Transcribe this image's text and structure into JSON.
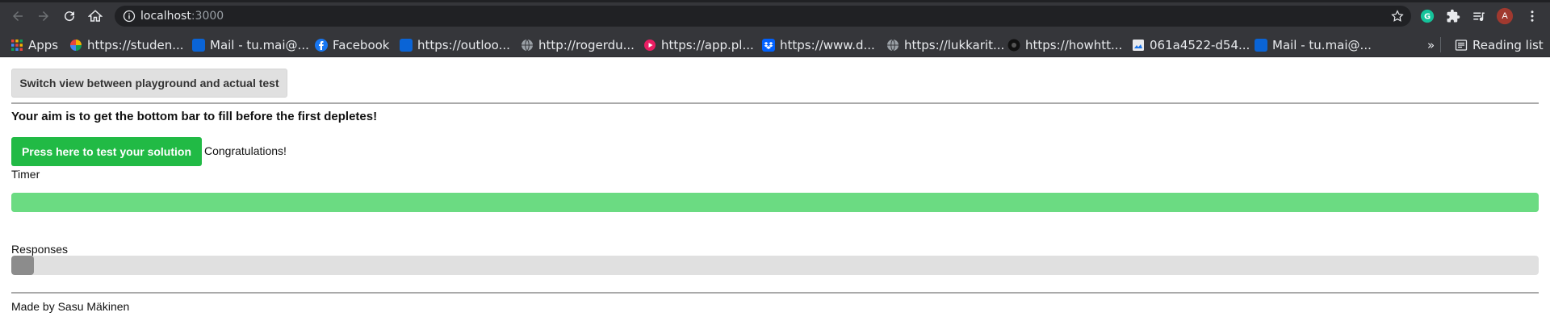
{
  "browser": {
    "url_host": "localhost",
    "url_port": ":3000",
    "profile_initial": "A",
    "bookmarks": [
      {
        "label": "Apps",
        "icon": "apps-grid-icon",
        "color": "#e8453c"
      },
      {
        "label": "https://studen...",
        "icon": "colorful-pinwheel-icon",
        "color": "#f4b400"
      },
      {
        "label": "Mail - tu.mai@...",
        "icon": "outlook-icon",
        "color": "#0a64d6"
      },
      {
        "label": "Facebook",
        "icon": "facebook-icon",
        "color": "#1877f2"
      },
      {
        "label": "https://outloo...",
        "icon": "outlook-icon",
        "color": "#0a64d6"
      },
      {
        "label": "http://rogerdu...",
        "icon": "globe-icon",
        "color": "#9aa0a6"
      },
      {
        "label": "https://app.pl...",
        "icon": "play-circle-icon",
        "color": "#e91e63"
      },
      {
        "label": "https://www.d...",
        "icon": "dropbox-icon",
        "color": "#0061ff"
      },
      {
        "label": "https://lukkarit...",
        "icon": "globe-icon",
        "color": "#9aa0a6"
      },
      {
        "label": "https://howhtt...",
        "icon": "dark-circle-icon",
        "color": "#111111"
      },
      {
        "label": "061a4522-d54...",
        "icon": "image-file-icon",
        "color": "#8ab4f8"
      },
      {
        "label": "Mail - tu.mai@...",
        "icon": "outlook-icon",
        "color": "#0a64d6"
      }
    ],
    "overflow_label": "»",
    "reading_list_label": "Reading list"
  },
  "page": {
    "switch_button_label": "Switch view between playground and actual test",
    "aim_text": "Your aim is to get the bottom bar to fill before the first depletes!",
    "test_button_label": "Press here to test your solution",
    "result_text": "Congratulations!",
    "timer_label": "Timer",
    "timer_fraction": 1.0,
    "responses_label": "Responses",
    "responses_fraction": 0.015,
    "footer_text": "Made by Sasu Mäkinen"
  },
  "colors": {
    "accent_green": "#21ba45",
    "timer_green": "#6bdb82",
    "response_gray": "#8c8c8c"
  }
}
